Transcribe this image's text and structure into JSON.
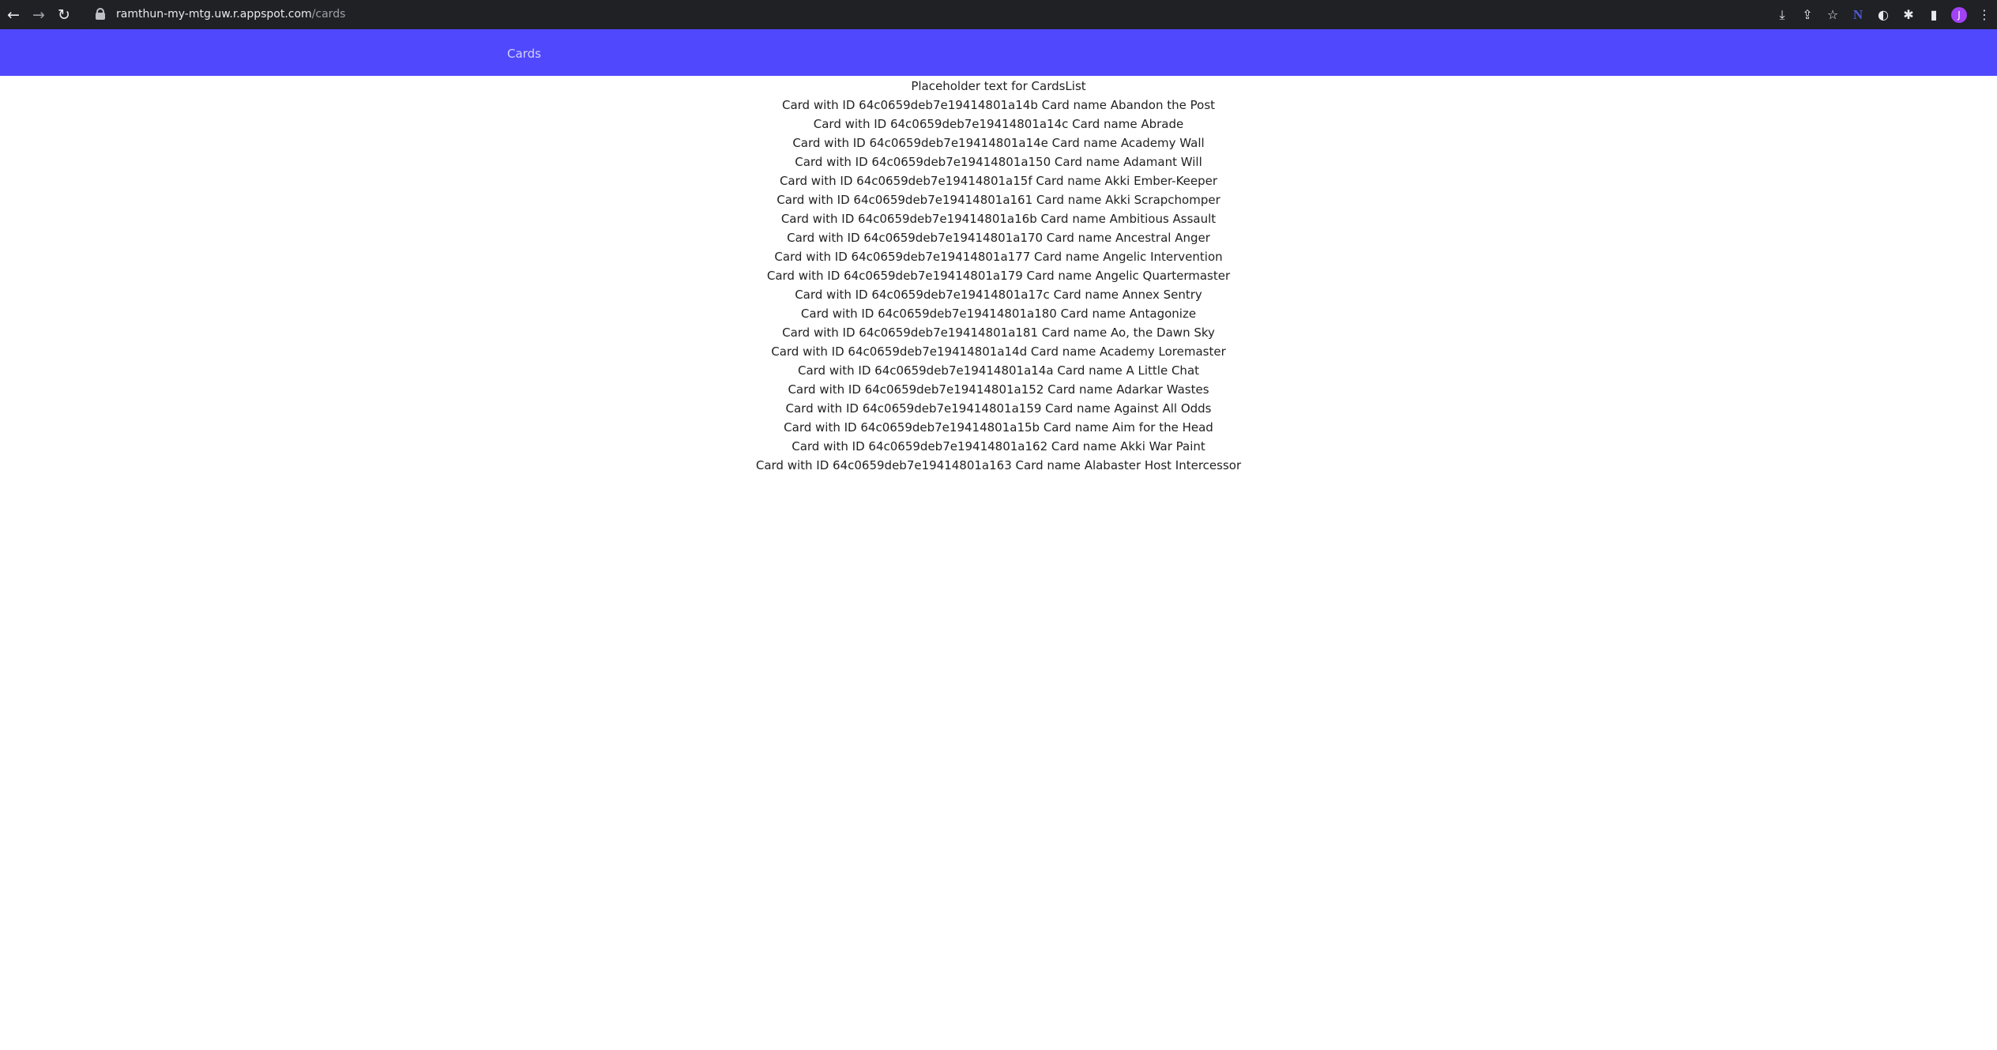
{
  "browser": {
    "back_icon": "←",
    "forward_icon": "→",
    "reload_icon": "↻",
    "url_host": "ramthun-my-mtg.uw.r.appspot.com",
    "url_path": "/cards",
    "icons": {
      "install": "⤓",
      "share": "⇪",
      "star": "☆",
      "extension_n": "N",
      "globe": "◐",
      "puzzle": "✱",
      "sidebar": "▮",
      "profile_initial": "J",
      "menu": "⋮"
    }
  },
  "header": {
    "link_label": "Cards",
    "bg_color": "#5048fc"
  },
  "main": {
    "placeholder": "Placeholder text for CardsList",
    "cards": [
      "Card with ID 64c0659deb7e19414801a14b Card name Abandon the Post",
      "Card with ID 64c0659deb7e19414801a14c Card name Abrade",
      "Card with ID 64c0659deb7e19414801a14e Card name Academy Wall",
      "Card with ID 64c0659deb7e19414801a150 Card name Adamant Will",
      "Card with ID 64c0659deb7e19414801a15f Card name Akki Ember-Keeper",
      "Card with ID 64c0659deb7e19414801a161 Card name Akki Scrapchomper",
      "Card with ID 64c0659deb7e19414801a16b Card name Ambitious Assault",
      "Card with ID 64c0659deb7e19414801a170 Card name Ancestral Anger",
      "Card with ID 64c0659deb7e19414801a177 Card name Angelic Intervention",
      "Card with ID 64c0659deb7e19414801a179 Card name Angelic Quartermaster",
      "Card with ID 64c0659deb7e19414801a17c Card name Annex Sentry",
      "Card with ID 64c0659deb7e19414801a180 Card name Antagonize",
      "Card with ID 64c0659deb7e19414801a181 Card name Ao, the Dawn Sky",
      "Card with ID 64c0659deb7e19414801a14d Card name Academy Loremaster",
      "Card with ID 64c0659deb7e19414801a14a Card name A Little Chat",
      "Card with ID 64c0659deb7e19414801a152 Card name Adarkar Wastes",
      "Card with ID 64c0659deb7e19414801a159 Card name Against All Odds",
      "Card with ID 64c0659deb7e19414801a15b Card name Aim for the Head",
      "Card with ID 64c0659deb7e19414801a162 Card name Akki War Paint",
      "Card with ID 64c0659deb7e19414801a163 Card name Alabaster Host Intercessor"
    ]
  }
}
